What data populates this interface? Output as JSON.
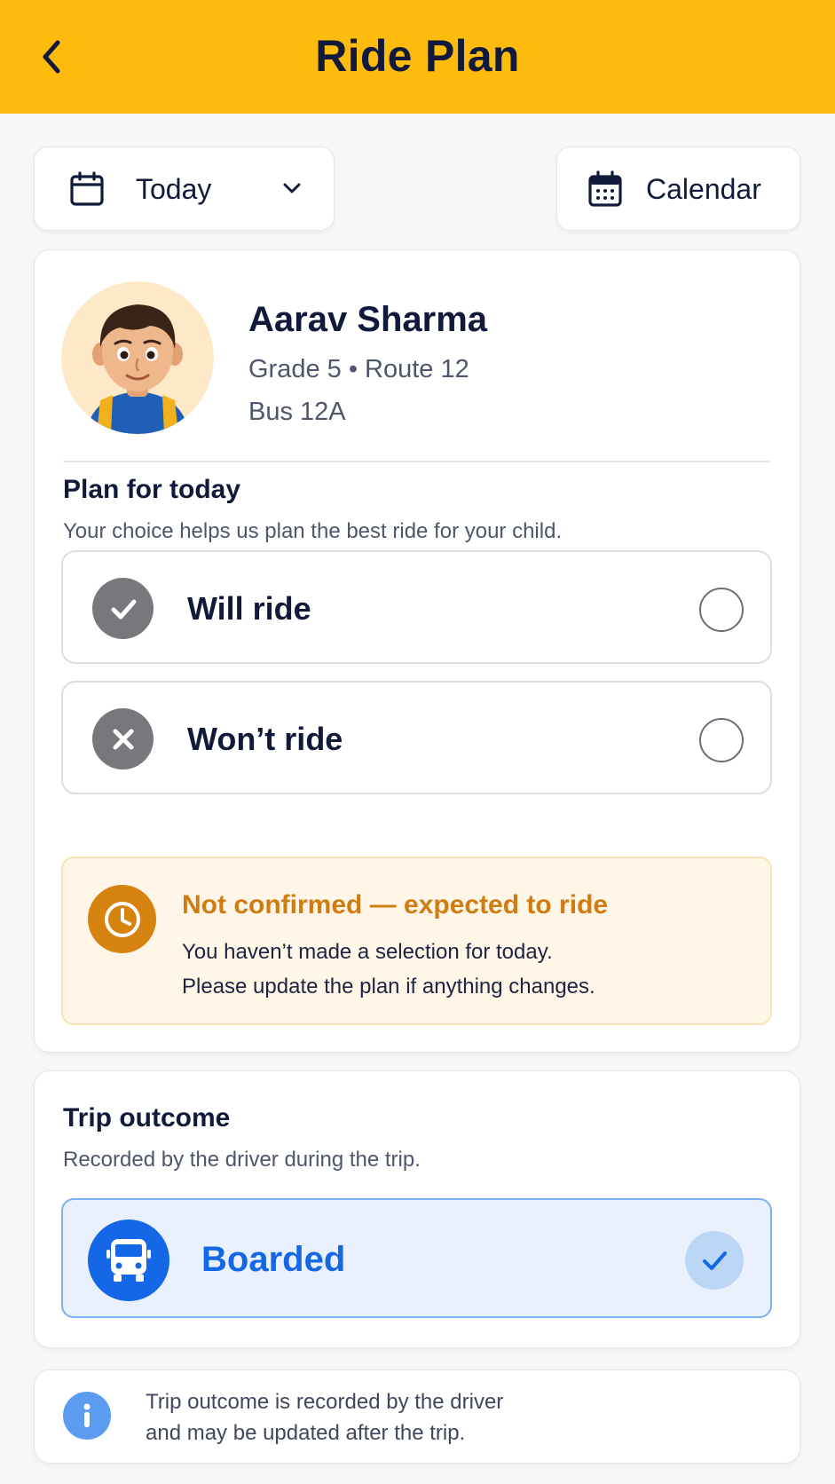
{
  "header": {
    "title": "Ride Plan",
    "back_icon": "chevron-left-icon"
  },
  "date_picker": {
    "label": "Today",
    "icon": "calendar-icon",
    "dropdown_icon": "chevron-down-icon"
  },
  "calendar_button": {
    "label": "Calendar",
    "icon": "calendar-grid-icon"
  },
  "child": {
    "name": "Aarav Sharma",
    "meta": "Grade 5 • Route 12",
    "bus": "Bus 12A"
  },
  "plan": {
    "title": "Plan for today",
    "subtitle": "Your choice helps us plan the best ride for your child.",
    "options": [
      {
        "label": "Will ride",
        "icon": "check-icon",
        "selected": false
      },
      {
        "label": "Won’t ride",
        "icon": "x-icon",
        "selected": false
      }
    ]
  },
  "notice": {
    "icon": "clock-icon",
    "title": "Not confirmed — expected to ride",
    "line1": "You haven’t made a selection for today.",
    "line2": "Please update the plan if anything changes."
  },
  "trip": {
    "title": "Trip outcome",
    "subtitle": "Recorded by the driver during the trip.",
    "status": {
      "label": "Boarded",
      "icon": "bus-icon",
      "checked": true
    }
  },
  "info": {
    "icon": "info-icon",
    "line1": "Trip outcome is recorded by the driver",
    "line2": "and may be updated after the trip."
  },
  "colors": {
    "header_bg": "#fdbb0e",
    "warning": "#d6840f",
    "primary_blue": "#1467e6",
    "neutral_icon": "#77787c"
  }
}
